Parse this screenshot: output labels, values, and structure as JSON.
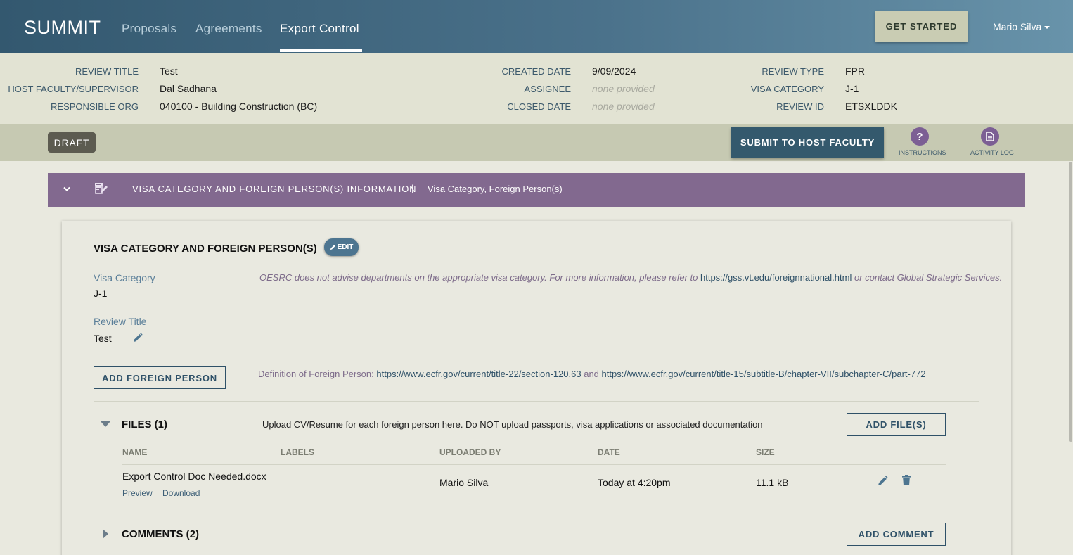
{
  "nav": {
    "logo": "SUMMIT",
    "links": [
      "Proposals",
      "Agreements",
      "Export Control"
    ],
    "active": "Export Control",
    "get_started": "GET STARTED",
    "user": "Mario Silva"
  },
  "header": {
    "review_title_label": "REVIEW TITLE",
    "review_title": "Test",
    "host_label": "HOST FACULTY/SUPERVISOR",
    "host": "Dal Sadhana",
    "org_label": "RESPONSIBLE ORG",
    "org": "040100 - Building Construction (BC)",
    "created_label": "CREATED DATE",
    "created": "9/09/2024",
    "assignee_label": "ASSIGNEE",
    "assignee": "none provided",
    "closed_label": "CLOSED DATE",
    "closed": "none provided",
    "review_type_label": "REVIEW TYPE",
    "review_type": "FPR",
    "visa_category_label": "VISA CATEGORY",
    "visa_category": "J-1",
    "review_id_label": "REVIEW ID",
    "review_id": "ETSXLDDK"
  },
  "actions": {
    "status": "DRAFT",
    "submit": "SUBMIT TO HOST FACULTY",
    "instructions_icon": "?",
    "instructions": "INSTRUCTIONS",
    "activity_log": "ACTIVITY LOG"
  },
  "section": {
    "title": "VISA CATEGORY AND FOREIGN PERSON(S) INFORMATION",
    "separator": "|",
    "subtitle": "Visa Category, Foreign Person(s)"
  },
  "card": {
    "title": "VISA CATEGORY AND FOREIGN PERSON(S)",
    "edit": "EDIT",
    "visa_label": "Visa Category",
    "visa_value": "J-1",
    "note_prefix": "OESRC does not advise departments on the appropriate visa category. For more information, please refer to",
    "note_link": "https://gss.vt.edu/foreignnational.html",
    "note_suffix": "or contact Global Strategic Services.",
    "review_title_label": "Review Title",
    "review_title_value": "Test",
    "add_foreign_person": "ADD FOREIGN PERSON",
    "def_prefix": "Definition of Foreign Person:",
    "def_link1": "https://www.ecfr.gov/current/title-22/section-120.63",
    "def_and": "and",
    "def_link2": "https://www.ecfr.gov/current/title-15/subtitle-B/chapter-VII/subchapter-C/part-772"
  },
  "files": {
    "title": "FILES (1)",
    "note": "Upload CV/Resume for each foreign person here. Do NOT upload passports, visa applications or associated documentation",
    "add": "ADD FILE(S)",
    "columns": [
      "NAME",
      "LABELS",
      "UPLOADED BY",
      "DATE",
      "SIZE"
    ],
    "rows": [
      {
        "name": "Export Control Doc Needed.docx",
        "preview": "Preview",
        "download": "Download",
        "labels": "",
        "uploaded_by": "Mario Silva",
        "date": "Today at 4:20pm",
        "size": "11.1 kB"
      }
    ]
  },
  "comments": {
    "title": "COMMENTS (2)",
    "add": "ADD COMMENT"
  },
  "colors": {
    "nav_dark": "#33586f",
    "accent_purple": "#82698f",
    "primary_button": "#34596d",
    "info_bg": "#e2e3d3"
  }
}
